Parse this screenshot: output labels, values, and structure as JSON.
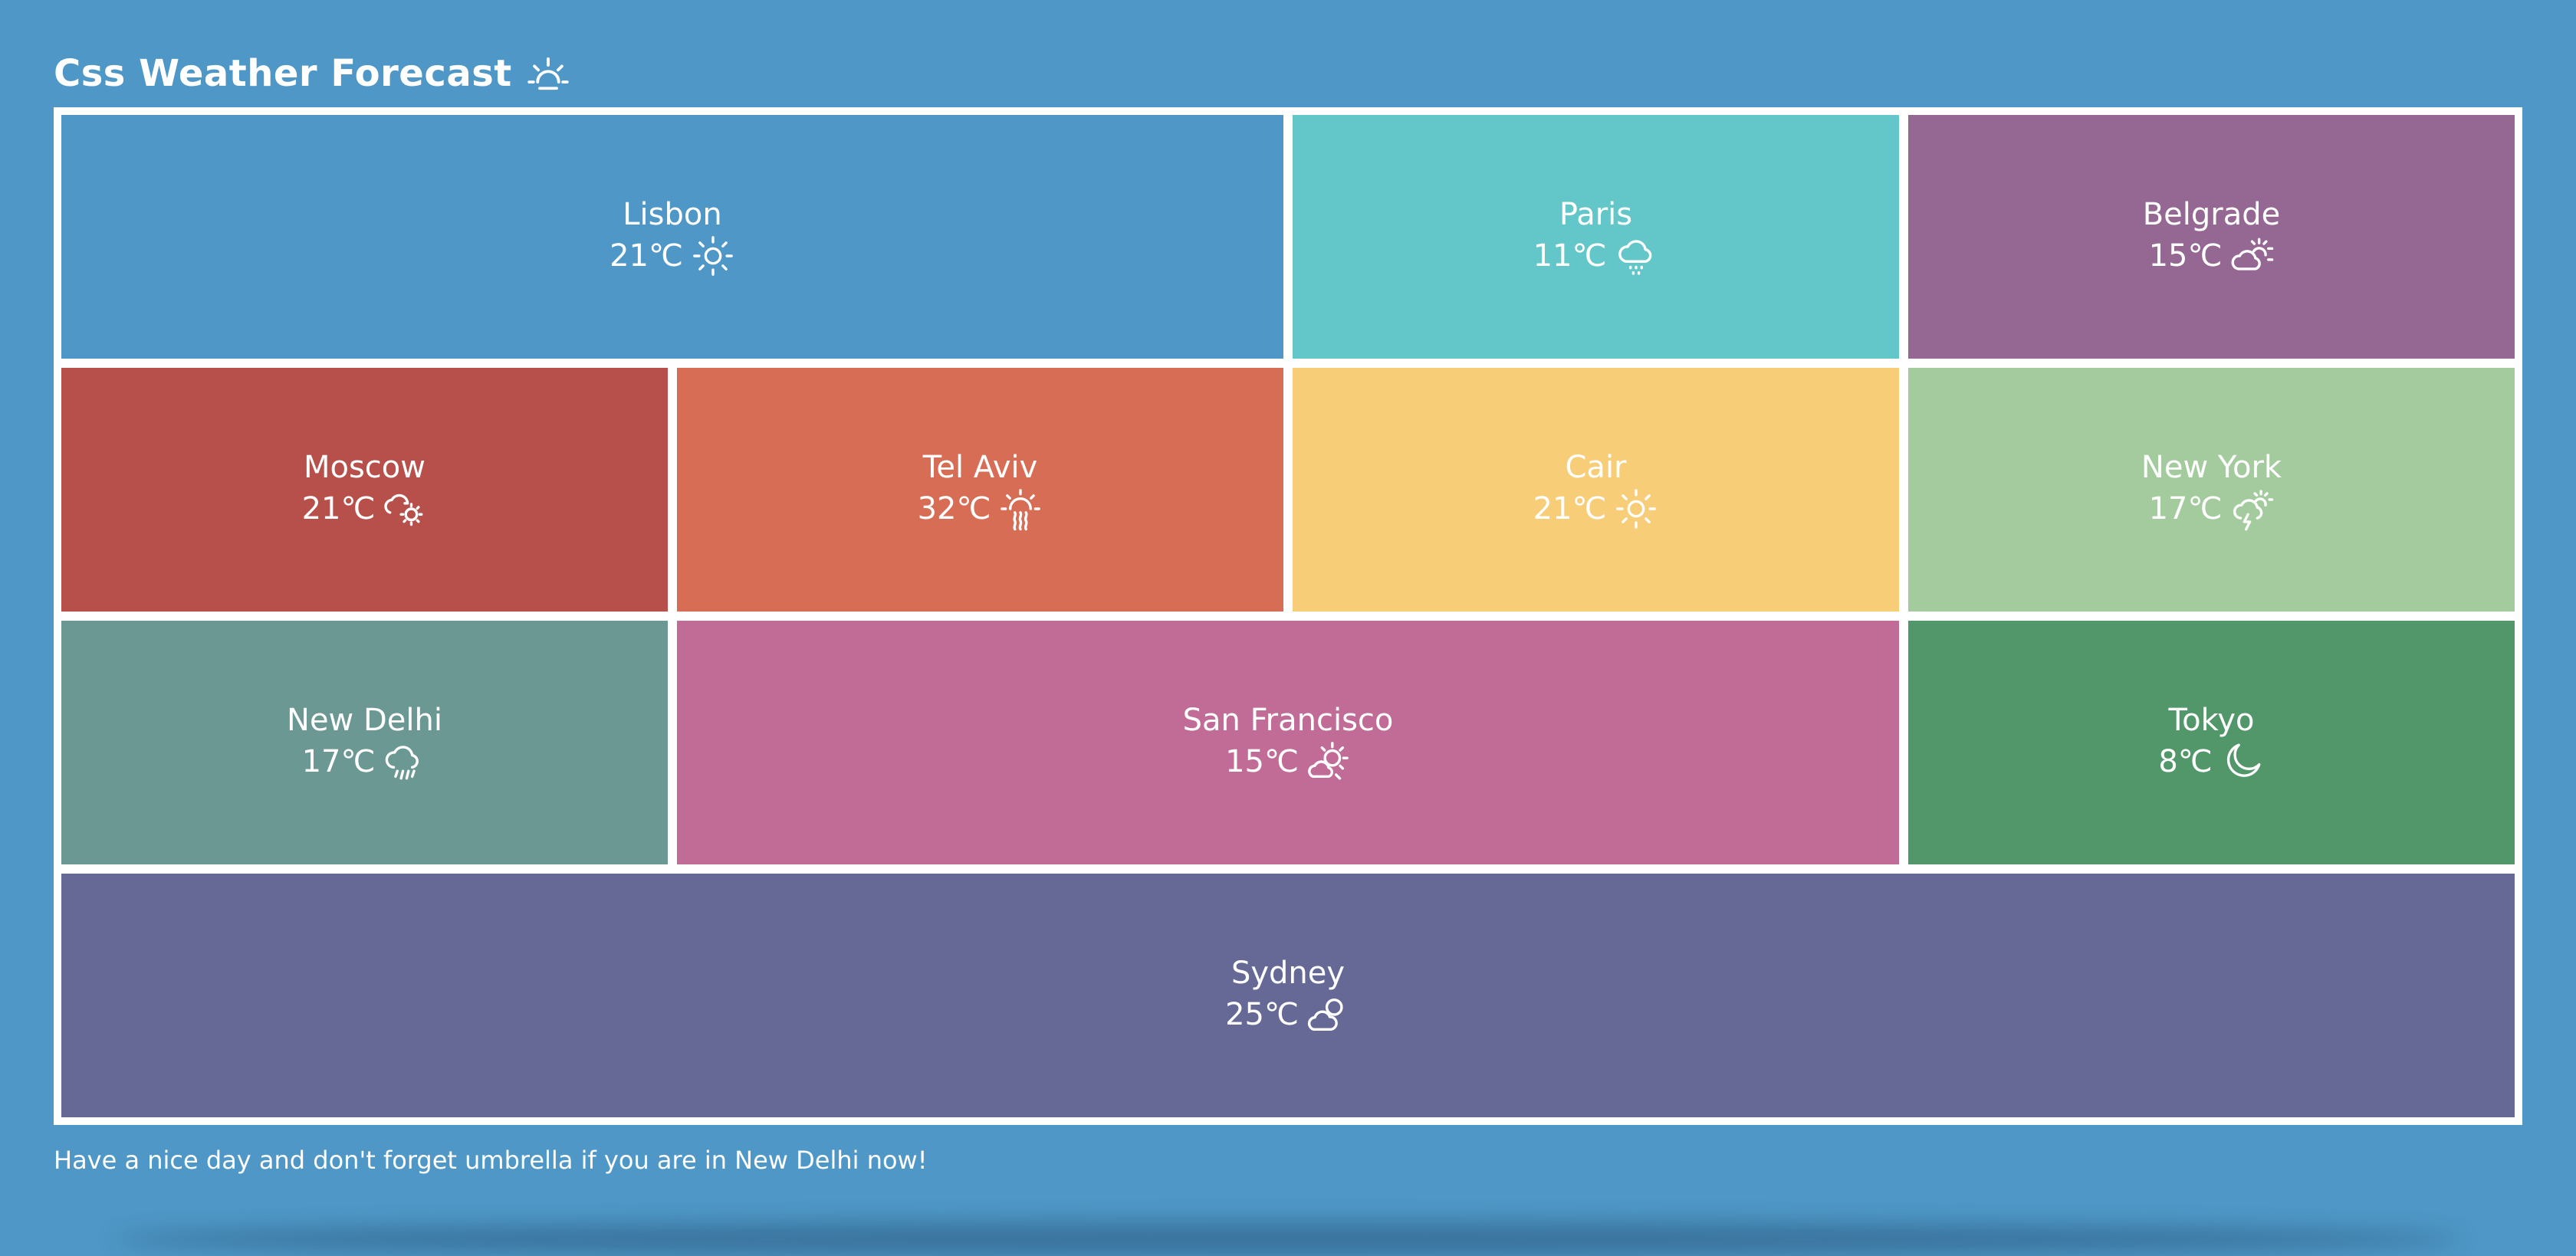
{
  "header": {
    "title": "Css Weather Forecast",
    "title_icon": "sunrise-icon"
  },
  "cities": [
    {
      "name": "Lisbon",
      "temp": "21℃",
      "icon": "sun-icon",
      "color": "#4f97c6",
      "col": "1 / span 2",
      "row": "1"
    },
    {
      "name": "Paris",
      "temp": "11℃",
      "icon": "cloud-drizzle-icon",
      "color": "#63c7c9",
      "col": "3",
      "row": "1"
    },
    {
      "name": "Belgrade",
      "temp": "15℃",
      "icon": "partly-cloudy-icon",
      "color": "#946893",
      "col": "4",
      "row": "1"
    },
    {
      "name": "Moscow",
      "temp": "21℃",
      "icon": "cloud-sun-icon",
      "color": "#b74f4b",
      "col": "1",
      "row": "2"
    },
    {
      "name": "Tel Aviv",
      "temp": "32℃",
      "icon": "sun-haze-icon",
      "color": "#d66d54",
      "col": "2",
      "row": "2"
    },
    {
      "name": "Cair",
      "temp": "21℃",
      "icon": "sun-icon",
      "color": "#f8cd77",
      "col": "3",
      "row": "2"
    },
    {
      "name": "New York",
      "temp": "17℃",
      "icon": "storm-sun-icon",
      "color": "#a4cb9d",
      "col": "4",
      "row": "2"
    },
    {
      "name": "New Delhi",
      "temp": "17℃",
      "icon": "cloud-rain-icon",
      "color": "#6b9893",
      "col": "1",
      "row": "3"
    },
    {
      "name": "San Francisco",
      "temp": "15℃",
      "icon": "sun-behind-cloud-icon",
      "color": "#c16c96",
      "col": "2 / span 2",
      "row": "3"
    },
    {
      "name": "Tokyo",
      "temp": "8℃",
      "icon": "moon-icon",
      "color": "#52976a",
      "col": "4",
      "row": "3"
    },
    {
      "name": "Sydney",
      "temp": "25℃",
      "icon": "cloud-sun-small-icon",
      "color": "#666995",
      "col": "1 / span 4",
      "row": "4"
    }
  ],
  "footer": {
    "message": "Have a nice day and don't forget umbrella if you are in New Delhi now!"
  }
}
